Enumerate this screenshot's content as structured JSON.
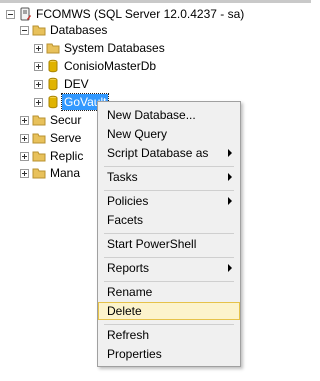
{
  "tree": {
    "server": {
      "label": "FCOMWS (SQL Server 12.0.4237 - sa)",
      "icon": "server-icon"
    },
    "databases": {
      "label": "Databases",
      "icon": "folder-icon"
    },
    "system_databases": {
      "label": "System Databases",
      "icon": "folder-icon"
    },
    "conisio": {
      "label": "ConisioMasterDb",
      "icon": "database-icon"
    },
    "dev": {
      "label": "DEV",
      "icon": "database-icon"
    },
    "govault": {
      "label": "GoVault",
      "icon": "database-icon"
    },
    "security": {
      "label": "Secur",
      "icon": "folder-icon"
    },
    "server_objects": {
      "label": "Serve",
      "icon": "folder-icon"
    },
    "replication": {
      "label": "Replic",
      "icon": "folder-icon"
    },
    "management": {
      "label": "Mana",
      "icon": "folder-icon"
    }
  },
  "context_menu": {
    "items": [
      {
        "label": "New Database..."
      },
      {
        "label": "New Query"
      },
      {
        "label": "Script Database as",
        "submenu": true
      },
      {
        "label": "Tasks",
        "submenu": true
      },
      {
        "label": "Policies",
        "submenu": true
      },
      {
        "label": "Facets"
      },
      {
        "label": "Start PowerShell"
      },
      {
        "label": "Reports",
        "submenu": true
      },
      {
        "label": "Rename"
      },
      {
        "label": "Delete",
        "highlighted": true
      },
      {
        "label": "Refresh"
      },
      {
        "label": "Properties"
      }
    ]
  },
  "colors": {
    "selection": "#3399ff",
    "menu_background": "#f0f0f0",
    "menu_highlight": "#fcf3cc",
    "folder": "#e8c15b",
    "database": "#e0b300"
  }
}
